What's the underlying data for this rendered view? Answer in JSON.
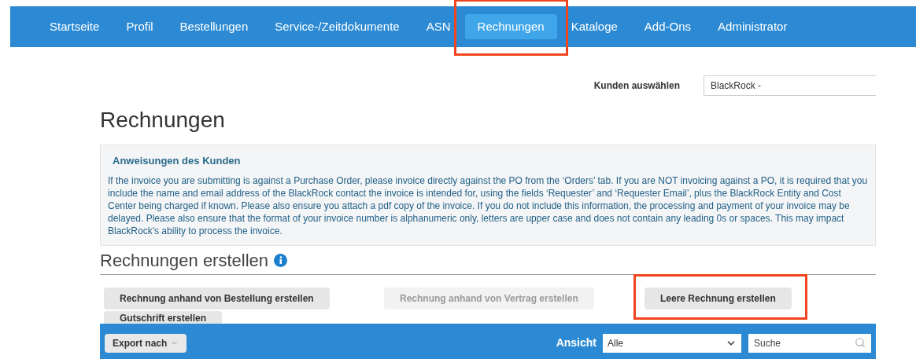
{
  "nav": {
    "items": [
      {
        "label": "Startseite",
        "selected": false
      },
      {
        "label": "Profil",
        "selected": false
      },
      {
        "label": "Bestellungen",
        "selected": false
      },
      {
        "label": "Service-/Zeitdokumente",
        "selected": false
      },
      {
        "label": "ASN",
        "selected": false
      },
      {
        "label": "Rechnungen",
        "selected": true
      },
      {
        "label": "Kataloge",
        "selected": false
      },
      {
        "label": "Add-Ons",
        "selected": false
      },
      {
        "label": "Administrator",
        "selected": false
      }
    ]
  },
  "customer": {
    "label": "Kunden auswählen",
    "value": "BlackRock -"
  },
  "title": "Rechnungen",
  "instructions": {
    "heading": "Anweisungen des Kunden",
    "text": "If the invoice you are submitting is against a Purchase Order, please invoice directly against the PO from the ‘Orders’ tab. If you are NOT invoicing against a PO, it is required that you include the name and email address of the BlackRock contact the invoice is intended for, using the fields ‘Requester’ and ‘Requester Email’, plus the BlackRock Entity and Cost Center being charged if known. Please also ensure you attach a pdf copy of the invoice. If you do not include this information, the processing and payment of your invoice may be delayed. Please also ensure that the format of your invoice number is alphanumeric only, letters are upper case and does not contain any leading 0s or spaces. This may impact BlackRock's ability to process the invoice."
  },
  "create": {
    "heading": "Rechnungen erstellen",
    "buttons": [
      {
        "label": "Rechnung anhand von Bestellung erstellen",
        "disabled": false,
        "highlighted": false
      },
      {
        "label": "Rechnung anhand von Vertrag erstellen",
        "disabled": true,
        "highlighted": false
      },
      {
        "label": "Leere Rechnung erstellen",
        "disabled": false,
        "highlighted": true
      },
      {
        "label": "Gutschrift erstellen",
        "disabled": false,
        "highlighted": false
      }
    ]
  },
  "toolbar": {
    "export": "Export nach",
    "view_label": "Ansicht",
    "view_value": "Alle",
    "search_placeholder": "Suche"
  }
}
